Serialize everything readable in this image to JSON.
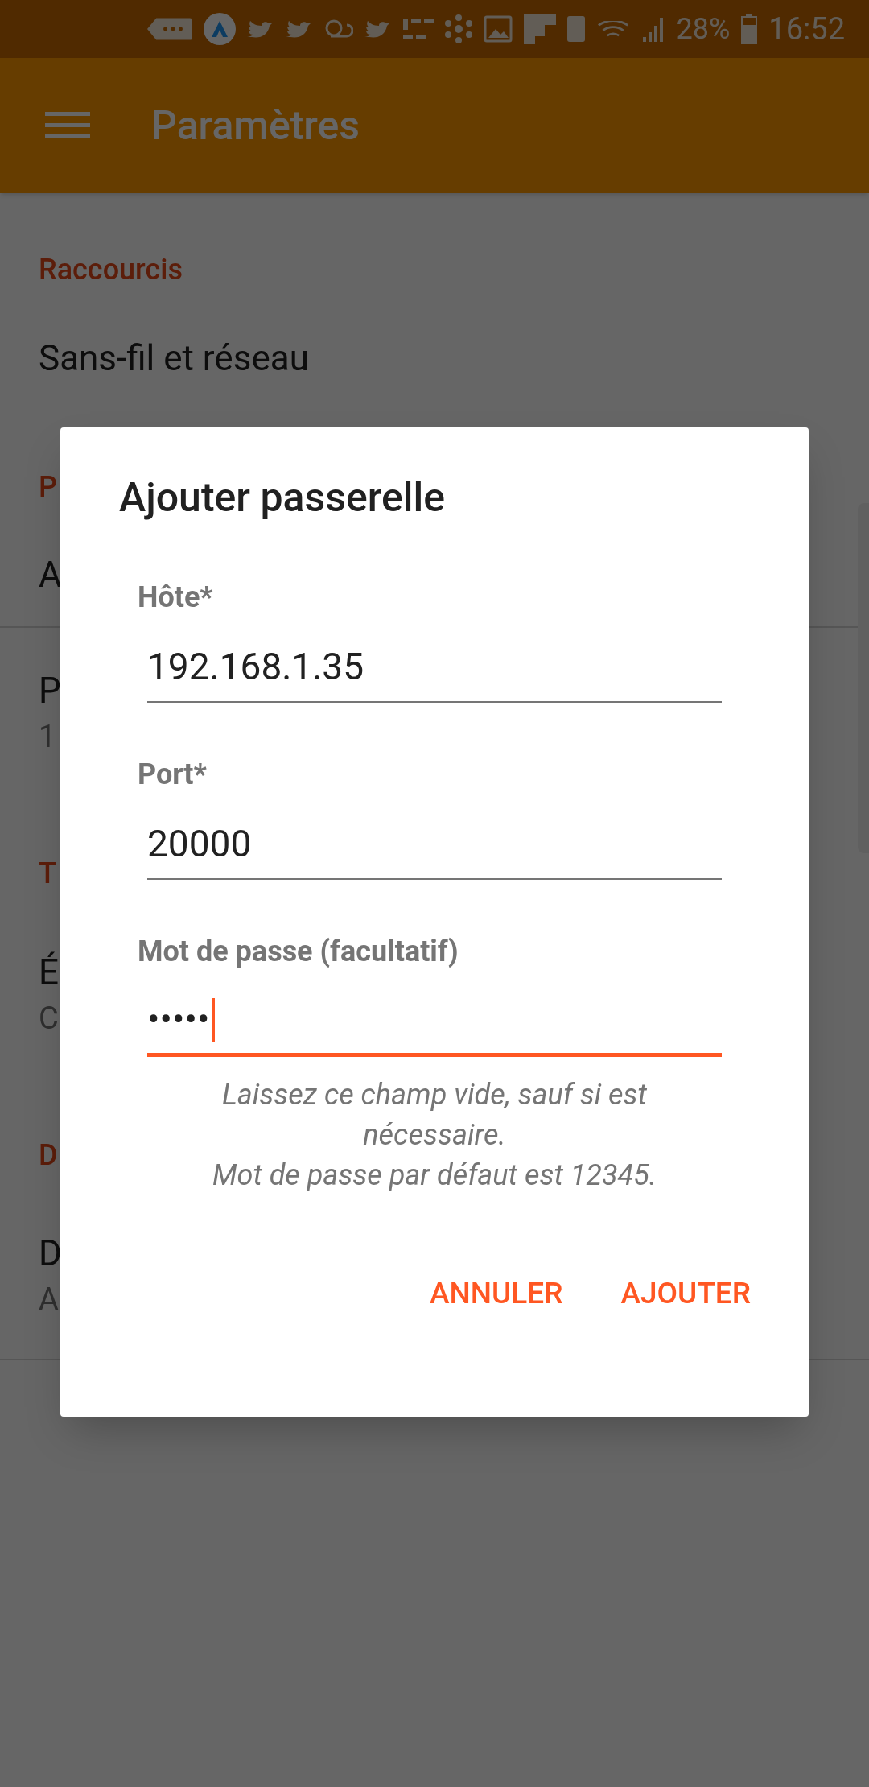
{
  "status_bar": {
    "battery": "28%",
    "time": "16:52"
  },
  "app_bar": {
    "title": "Paramètres"
  },
  "settings": [
    {
      "kind": "header",
      "text": "Raccourcis"
    },
    {
      "kind": "item",
      "title": "Sans-fil et réseau"
    },
    {
      "kind": "header",
      "text": "P"
    },
    {
      "kind": "item",
      "title": "A",
      "divider": true
    },
    {
      "kind": "item",
      "title": "P",
      "subtitle": "1"
    },
    {
      "kind": "header",
      "text": "T"
    },
    {
      "kind": "item",
      "title": "É",
      "subtitle": "C"
    },
    {
      "kind": "header",
      "text": "D"
    },
    {
      "kind": "item",
      "title": "D",
      "subtitle": "A",
      "divider": true
    }
  ],
  "dialog": {
    "title": "Ajouter passerelle",
    "fields": [
      {
        "label": "Hôte*",
        "value": "192.168.1.35",
        "focused": false
      },
      {
        "label": "Port*",
        "value": "20000",
        "focused": false
      },
      {
        "label": "Mot de passe (facultatif)",
        "value": "•••••",
        "focused": true
      }
    ],
    "hint": [
      "Laissez ce champ vide, sauf si est",
      "nécessaire.",
      "Mot de passe par défaut est 12345."
    ],
    "buttons": [
      "ANNULER",
      "AJOUTER"
    ]
  }
}
